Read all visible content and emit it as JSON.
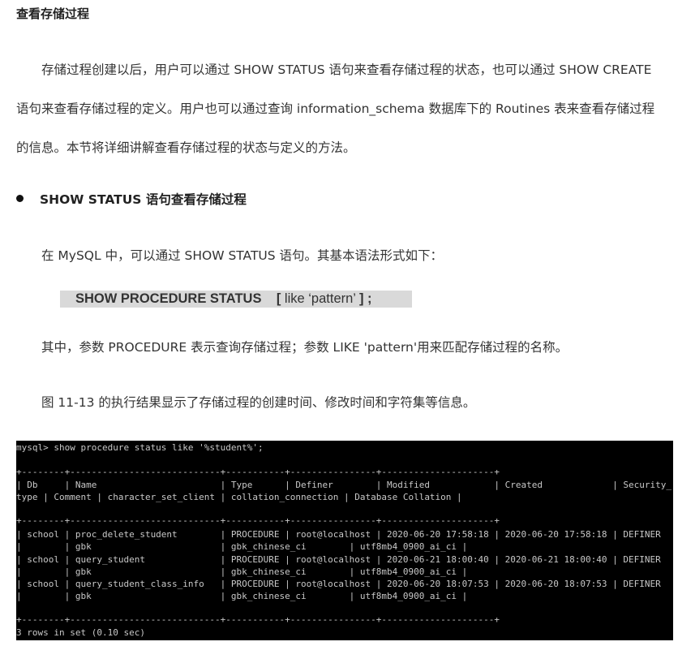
{
  "heading": "查看存储过程",
  "intro_lines": [
    "　　存储过程创建以后，用户可以通过 SHOW STATUS 语句来查看存储过程的状态，也可以通过 SHOW CREATE",
    "语句来查看存储过程的定义。用户也可以通过查询 information_schema 数据库下的 Routines 表来查看存储过程",
    "的信息。本节将详细讲解查看存储过程的状态与定义的方法。"
  ],
  "bullet_title": "SHOW STATUS 语句查看存储过程",
  "syntax_intro": "　　在 MySQL 中，可以通过 SHOW STATUS 语句。其基本语法形式如下：",
  "syntax": {
    "keyword": "SHOW PROCEDURE STATUS",
    "bracket_open": "[",
    "pattern": " like ‘pattern’ ",
    "bracket_close": "]",
    "semicolon": " ;"
  },
  "param_note": "　　其中，参数 PROCEDURE 表示查询存储过程；参数 LIKE 'pattern'用来匹配存储过程的名称。",
  "figure_note": "　　图 11-13 的执行结果显示了存储过程的创建时间、修改时间和字符集等信息。",
  "terminal": {
    "command": "mysql> show procedure status like '%student%';",
    "separator": "+--------+----------------------------+-----------+----------------+---------------------+",
    "header_1": "| Db     | Name                       | Type      | Definer        | Modified            | Created             | Security_",
    "header_2": "type | Comment | character_set_client | collation_connection | Database Collation |",
    "rows": [
      {
        "line1": "| school | proc_delete_student        | PROCEDURE | root@localhost | 2020-06-20 17:58:18 | 2020-06-20 17:58:18 | DEFINER",
        "line2": "|        | gbk                        | gbk_chinese_ci        | utf8mb4_0900_ai_ci |"
      },
      {
        "line1": "| school | query_student              | PROCEDURE | root@localhost | 2020-06-21 18:00:40 | 2020-06-21 18:00:40 | DEFINER",
        "line2": "|        | gbk                        | gbk_chinese_ci        | utf8mb4_0900_ai_ci |"
      },
      {
        "line1": "| school | query_student_class_info   | PROCEDURE | root@localhost | 2020-06-20 18:07:53 | 2020-06-20 18:07:53 | DEFINER",
        "line2": "|        | gbk                        | gbk_chinese_ci        | utf8mb4_0900_ai_ci |"
      }
    ],
    "footer": "3 rows in set (0.10 sec)"
  }
}
